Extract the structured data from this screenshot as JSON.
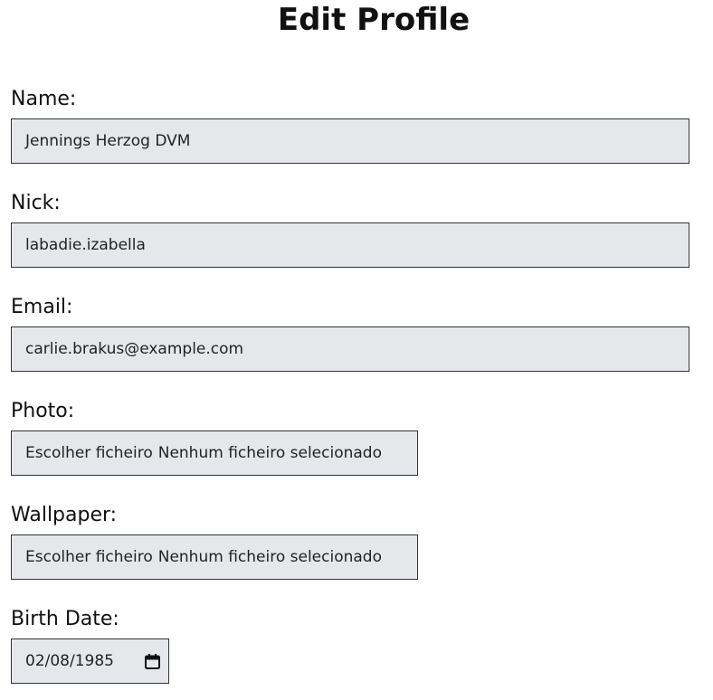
{
  "page": {
    "title": "Edit Profile"
  },
  "form": {
    "name": {
      "label": "Name:",
      "value": "Jennings Herzog DVM"
    },
    "nick": {
      "label": "Nick:",
      "value": "labadie.izabella"
    },
    "email": {
      "label": "Email:",
      "value": "carlie.brakus@example.com"
    },
    "photo": {
      "label": "Photo:",
      "button": "Escolher ficheiro",
      "status": "Nenhum ficheiro selecionado"
    },
    "wallpaper": {
      "label": "Wallpaper:",
      "button": "Escolher ficheiro",
      "status": "Nenhum ficheiro selecionado"
    },
    "birth_date": {
      "label": "Birth Date:",
      "value": "02/08/1985",
      "icon": "calendar-icon"
    }
  },
  "colors": {
    "input_bg": "#e6e7eb",
    "input_border": "#333333",
    "text": "#111111"
  }
}
